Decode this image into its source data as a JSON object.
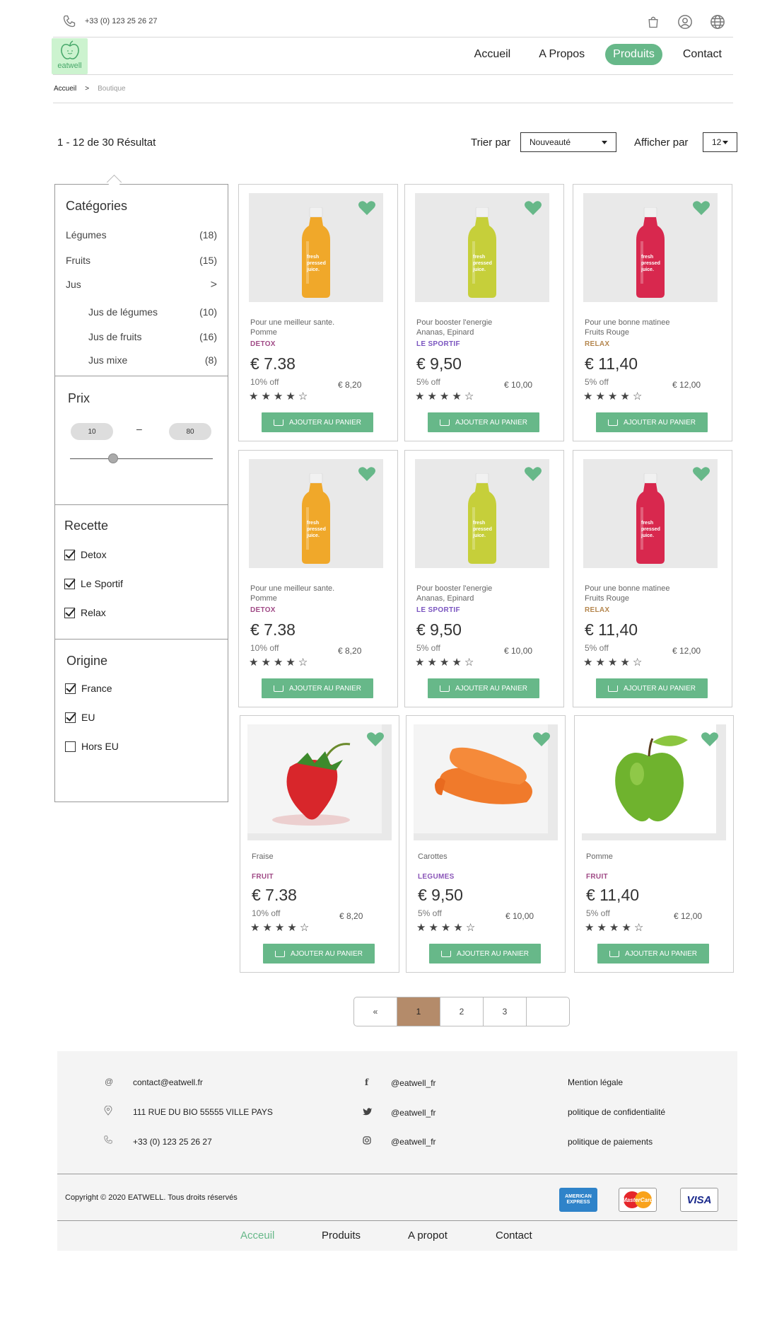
{
  "header": {
    "phone": "+33 (0) 123 25 26 27",
    "logo_text": "eatwell",
    "nav": [
      {
        "label": "Accueil",
        "active": false
      },
      {
        "label": "A Propos",
        "active": false
      },
      {
        "label": "Produits",
        "active": true
      },
      {
        "label": "Contact",
        "active": false
      }
    ],
    "breadcrumb": {
      "home": "Accueil",
      "sep": ">",
      "current": "Boutique"
    }
  },
  "toolbar": {
    "results": "1 - 12 de 30 Résultat",
    "sort_label": "Trier par",
    "sort_value": "Nouveauté",
    "perpage_label": "Afficher par",
    "perpage_value": "12"
  },
  "sidebar": {
    "categories_title": "Catégories",
    "categories": [
      {
        "label": "Légumes",
        "count": "(18)"
      },
      {
        "label": "Fruits",
        "count": "(15)"
      },
      {
        "label": "Jus",
        "count": ">"
      }
    ],
    "subcategories": [
      {
        "label": "Jus de légumes",
        "count": "(10)"
      },
      {
        "label": "Jus de fruits",
        "count": "(16)"
      },
      {
        "label": "Jus mixe",
        "count": "(8)"
      }
    ],
    "price_title": "Prix",
    "price_min": "10",
    "price_dash": "–",
    "price_max": "80",
    "price_slider_fraction": 0.3,
    "recipe_title": "Recette",
    "recipes": [
      {
        "label": "Detox",
        "checked": true
      },
      {
        "label": "Le Sportif",
        "checked": true
      },
      {
        "label": "Relax",
        "checked": true
      }
    ],
    "origin_title": "Origine",
    "origins": [
      {
        "label": "France",
        "checked": true
      },
      {
        "label": "EU",
        "checked": true
      },
      {
        "label": "Hors EU",
        "checked": false
      }
    ]
  },
  "products": [
    {
      "line1": "Pour une meilleur sante.",
      "line2": "Pomme",
      "tag": "DETOX",
      "tag_color": "#a04a86",
      "price": "€ 7.38",
      "off": "10% off",
      "old": "€ 8,20",
      "rating": 4,
      "button": "AJOUTER AU PANIER",
      "image": "juice-orange",
      "bottle_color": "#f0a82a"
    },
    {
      "line1": "Pour booster l'energie",
      "line2": "Ananas, Epinard",
      "tag": "LE SPORTIF",
      "tag_color": "#7a55c0",
      "price": "€ 9,50",
      "off": "5% off",
      "old": "€ 10,00",
      "rating": 4,
      "button": "AJOUTER AU PANIER",
      "image": "juice-green",
      "bottle_color": "#c6cf3a"
    },
    {
      "line1": "Pour une bonne matinee",
      "line2": "Fruits Rouge",
      "tag": "RELAX",
      "tag_color": "#b5874f",
      "price": "€ 11,40",
      "off": "5% off",
      "old": "€ 12,00",
      "rating": 4,
      "button": "AJOUTER AU PANIER",
      "image": "juice-red",
      "bottle_color": "#d8284e"
    },
    {
      "line1": "Pour une meilleur sante.",
      "line2": "Pomme",
      "tag": "DETOX",
      "tag_color": "#a04a86",
      "price": "€ 7.38",
      "off": "10% off",
      "old": "€ 8,20",
      "rating": 4,
      "button": "AJOUTER AU PANIER",
      "image": "juice-orange",
      "bottle_color": "#f0a82a"
    },
    {
      "line1": "Pour booster l'energie",
      "line2": "Ananas, Epinard",
      "tag": "LE SPORTIF",
      "tag_color": "#7a55c0",
      "price": "€ 9,50",
      "off": "5% off",
      "old": "€ 10,00",
      "rating": 4,
      "button": "AJOUTER AU PANIER",
      "image": "juice-green",
      "bottle_color": "#c6cf3a"
    },
    {
      "line1": "Pour une bonne matinee",
      "line2": "Fruits Rouge",
      "tag": "RELAX",
      "tag_color": "#b5874f",
      "price": "€ 11,40",
      "off": "5% off",
      "old": "€ 12,00",
      "rating": 4,
      "button": "AJOUTER AU PANIER",
      "image": "juice-red",
      "bottle_color": "#d8284e"
    },
    {
      "line1": "Fraise",
      "line2": "",
      "tag": "FRUIT",
      "tag_color": "#a04a86",
      "price": "€ 7.38",
      "off": "10% off",
      "old": "€ 8,20",
      "rating": 4,
      "button": "AJOUTER AU PANIER",
      "image": "strawberry"
    },
    {
      "line1": "Carottes",
      "line2": "",
      "tag": "LEGUMES",
      "tag_color": "#8a55b8",
      "price": "€ 9,50",
      "off": "5% off",
      "old": "€ 10,00",
      "rating": 4,
      "button": "AJOUTER AU PANIER",
      "image": "carrots"
    },
    {
      "line1": "Pomme",
      "line2": "",
      "tag": "FRUIT",
      "tag_color": "#a04a86",
      "price": "€ 11,40",
      "off": "5% off",
      "old": "€ 12,00",
      "rating": 4,
      "button": "AJOUTER AU PANIER",
      "image": "apple"
    }
  ],
  "pagination": {
    "prev": "«",
    "pages": [
      "1",
      "2",
      "3"
    ],
    "current": "1",
    "next": ""
  },
  "footer": {
    "email": "contact@eatwell.fr",
    "address": "111 RUE DU BIO 55555 VILLE PAYS",
    "phone": "+33 (0) 123 25 26 27",
    "facebook": "@eatwell_fr",
    "twitter": "@eatwell_fr",
    "instagram": "@eatwell_fr",
    "legal": "Mention légale",
    "privacy": "politique de confidentialité",
    "payments_policy": "politique de paiements",
    "copyright": "Copyright © 2020 EATWELL. Tous droits réservés",
    "payment_methods": [
      "AMERICAN EXPRESS",
      "MasterCard",
      "VISA"
    ],
    "nav": [
      {
        "label": "Acceuil",
        "active": true
      },
      {
        "label": "Produits",
        "active": false
      },
      {
        "label": "A propot",
        "active": false
      },
      {
        "label": "Contact",
        "active": false
      }
    ]
  },
  "colors": {
    "accent": "#67b889",
    "page_current": "#b48b6a",
    "logo_bg": "#ccf3cf"
  }
}
